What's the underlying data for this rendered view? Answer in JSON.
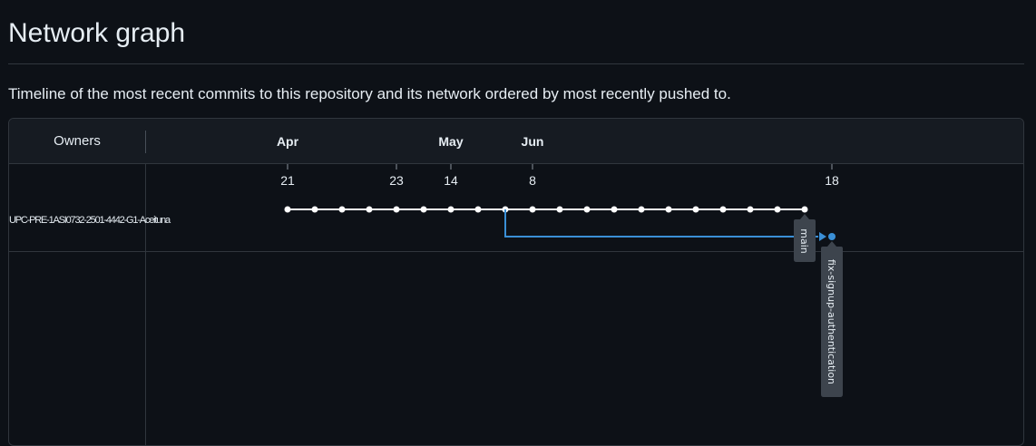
{
  "page": {
    "title": "Network graph",
    "description": "Timeline of the most recent commits to this repository and its network ordered by most recently pushed to."
  },
  "graph": {
    "owners_header": "Owners",
    "owners": [
      "UPC-PRE-1ASI0732-2501-4442-G1-Aceituna"
    ],
    "months": [
      "Apr",
      "May",
      "Jun"
    ],
    "days": [
      "21",
      "23",
      "14",
      "8",
      "18"
    ],
    "main_branch": {
      "name": "main",
      "commit_count": 20,
      "color": "#ffffff"
    },
    "feature_branch": {
      "name": "fix-signup-authentication",
      "commit_count": 1,
      "forks_from_commit": 9,
      "color": "#3a8fd6"
    },
    "colors": {
      "background": "#0d1117",
      "header_background": "#161b22",
      "border": "#30363d",
      "label_background": "#3d444d"
    }
  }
}
